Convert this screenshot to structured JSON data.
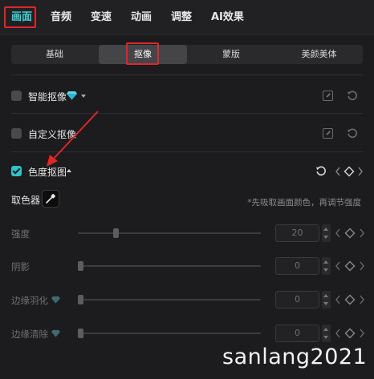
{
  "top_tabs": [
    {
      "label": "画面",
      "active": true
    },
    {
      "label": "音频",
      "active": false
    },
    {
      "label": "变速",
      "active": false
    },
    {
      "label": "动画",
      "active": false
    },
    {
      "label": "调整",
      "active": false
    },
    {
      "label": "AI效果",
      "active": false
    }
  ],
  "sub_tabs": [
    {
      "label": "基础",
      "active": false
    },
    {
      "label": "抠像",
      "active": true
    },
    {
      "label": "蒙版",
      "active": false
    },
    {
      "label": "美颜美体",
      "active": false
    }
  ],
  "sections": {
    "smart": {
      "label": "智能抠像",
      "checked": false,
      "icons": [
        "gem-icon",
        "chevron-down-icon",
        "edit-icon",
        "reset-icon"
      ]
    },
    "custom": {
      "label": "自定义抠像",
      "checked": false,
      "icons": [
        "edit-icon",
        "reset-icon"
      ]
    },
    "chroma": {
      "label": "色度抠图",
      "checked": true,
      "icons": [
        "chevron-up-icon",
        "reset-icon",
        "keyframe-icon"
      ]
    }
  },
  "picker": {
    "label": "取色器",
    "hint": "*先吸取画面颜色，再调节强度",
    "icon": "eyedropper-icon"
  },
  "params": [
    {
      "label": "强度",
      "value": "20",
      "level": 0.2,
      "premium": false
    },
    {
      "label": "阴影",
      "value": "0",
      "level": 0,
      "premium": false
    },
    {
      "label": "边缘羽化",
      "value": "0",
      "level": 0,
      "premium": true
    },
    {
      "label": "边缘清除",
      "value": "0",
      "level": 0,
      "premium": true
    }
  ],
  "watermark": "sanlang2021",
  "colors": {
    "accent": "#3ed0d6",
    "highlight_box": "#e0262b",
    "annotation_arrow": "#e0262b",
    "background": "#1c1c1e"
  }
}
